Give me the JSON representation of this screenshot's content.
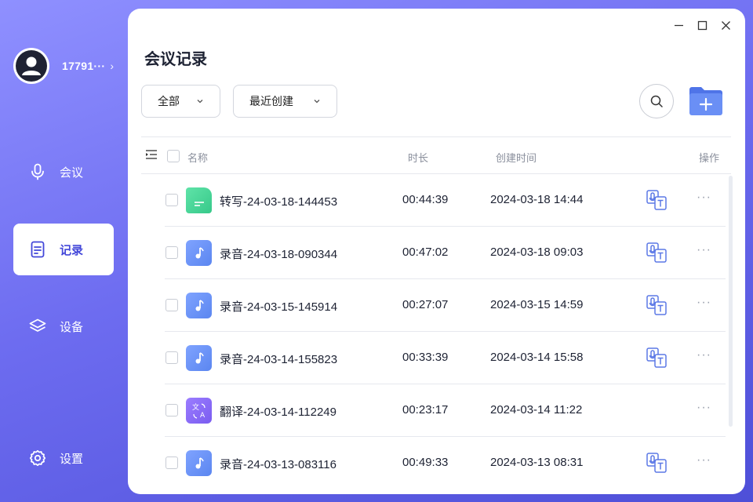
{
  "user": {
    "name": "17791···",
    "chevron": "›"
  },
  "nav": [
    {
      "label": "会议",
      "icon": "microphone-icon",
      "active": false
    },
    {
      "label": "记录",
      "icon": "document-icon",
      "active": true
    },
    {
      "label": "设备",
      "icon": "layers-icon",
      "active": false
    },
    {
      "label": "设置",
      "icon": "gear-icon",
      "active": false
    }
  ],
  "page": {
    "title": "会议记录"
  },
  "filters": {
    "type_label": "全部",
    "sort_label": "最近创建"
  },
  "table": {
    "headers": {
      "name": "名称",
      "duration": "时长",
      "created": "创建时间",
      "actions": "操作"
    },
    "rows": [
      {
        "type": "transcript",
        "name": "转写-24-03-18-144453",
        "duration": "00:44:39",
        "created": "2024-03-18 14:44",
        "has_transcribe_action": true,
        "more": "···"
      },
      {
        "type": "audio",
        "name": "录音-24-03-18-090344",
        "duration": "00:47:02",
        "created": "2024-03-18 09:03",
        "has_transcribe_action": true,
        "more": "···"
      },
      {
        "type": "audio",
        "name": "录音-24-03-15-145914",
        "duration": "00:27:07",
        "created": "2024-03-15 14:59",
        "has_transcribe_action": true,
        "more": "···"
      },
      {
        "type": "audio",
        "name": "录音-24-03-14-155823",
        "duration": "00:33:39",
        "created": "2024-03-14 15:58",
        "has_transcribe_action": true,
        "more": "···"
      },
      {
        "type": "translate",
        "name": "翻译-24-03-14-112249",
        "duration": "00:23:17",
        "created": "2024-03-14 11:22",
        "has_transcribe_action": false,
        "more": "···"
      },
      {
        "type": "audio",
        "name": "录音-24-03-13-083116",
        "duration": "00:49:33",
        "created": "2024-03-13 08:31",
        "has_transcribe_action": true,
        "more": "···"
      }
    ]
  },
  "translate_icon_text": {
    "top": "文",
    "bottom": "A"
  },
  "colors": {
    "accent": "#4347d9",
    "sidebar_gradient_start": "#8f90ff",
    "sidebar_gradient_end": "#4e4fd8"
  }
}
